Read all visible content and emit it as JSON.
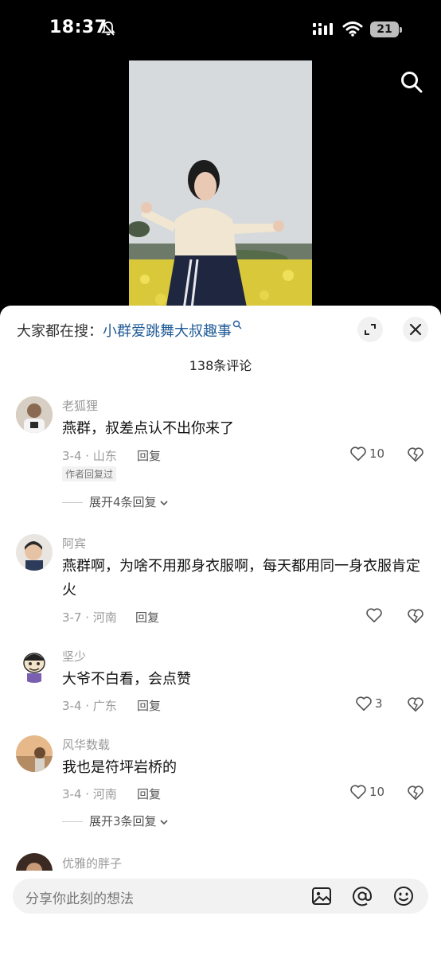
{
  "status": {
    "time": "18:37",
    "battery": "21"
  },
  "search": {
    "prefix": "大家都在搜：",
    "query": "小群爱跳舞大叔趣事"
  },
  "comment_count": "138条评论",
  "comments": [
    {
      "user": "老狐狸",
      "text": "燕群，叔差点认不出你来了",
      "meta": "3-4 · 山东",
      "reply": "回复",
      "likes": "10",
      "author_tag": "作者回复过",
      "expand": "展开4条回复"
    },
    {
      "user": "阿宾",
      "text": "燕群啊，为啥不用那身衣服啊，每天都用同一身衣服肯定火",
      "meta": "3-7 · 河南",
      "reply": "回复",
      "likes": ""
    },
    {
      "user": "坚少",
      "text": "大爷不白看，会点赞",
      "meta": "3-4 · 广东",
      "reply": "回复",
      "likes": "3"
    },
    {
      "user": "风华数载",
      "text": "我也是符坪岩桥的",
      "meta": "3-4 · 河南",
      "reply": "回复",
      "likes": "10",
      "expand": "展开3条回复"
    },
    {
      "user": "优雅的胖子"
    }
  ],
  "input": {
    "placeholder": "分享你此刻的想法"
  },
  "icons": [
    "bell-muted-icon",
    "signal-icon",
    "wifi-icon",
    "search-icon",
    "expand-icon",
    "close-icon",
    "heart-icon",
    "dislike-heart-icon",
    "chevron-down-icon",
    "image-icon",
    "at-icon",
    "emoji-icon"
  ]
}
